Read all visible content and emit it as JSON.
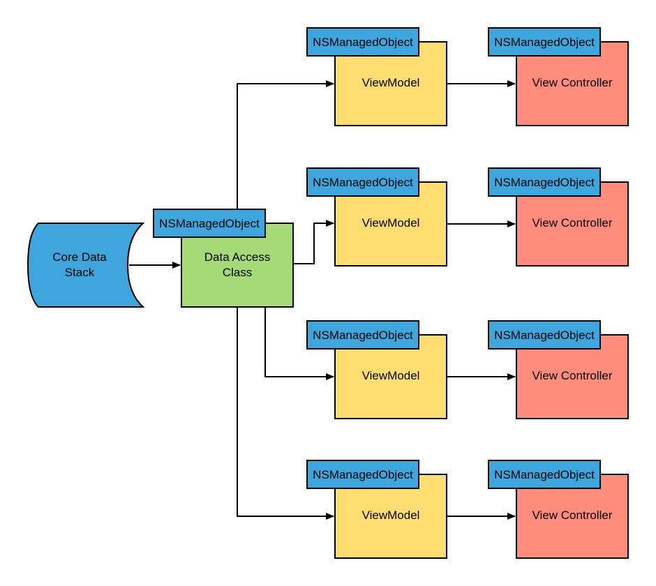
{
  "colors": {
    "storage": "#3ea6dd",
    "data_access": "#a6da78",
    "view_model": "#ffdd71",
    "view_controller": "#ff8c7c",
    "tag": "#3ea6dd"
  },
  "core_data_stack": {
    "line1": "Core Data",
    "line2": "Stack"
  },
  "data_access_class": {
    "tag": "NSManagedObject",
    "line1": "Data Access",
    "line2": "Class"
  },
  "rows": [
    {
      "view_model": {
        "tag": "NSManagedObject",
        "label": "ViewModel"
      },
      "view_controller": {
        "tag": "NSManagedObject",
        "label": "View Controller"
      }
    },
    {
      "view_model": {
        "tag": "NSManagedObject",
        "label": "ViewModel"
      },
      "view_controller": {
        "tag": "NSManagedObject",
        "label": "View Controller"
      }
    },
    {
      "view_model": {
        "tag": "NSManagedObject",
        "label": "ViewModel"
      },
      "view_controller": {
        "tag": "NSManagedObject",
        "label": "View Controller"
      }
    },
    {
      "view_model": {
        "tag": "NSManagedObject",
        "label": "ViewModel"
      },
      "view_controller": {
        "tag": "NSManagedObject",
        "label": "View Controller"
      }
    }
  ]
}
